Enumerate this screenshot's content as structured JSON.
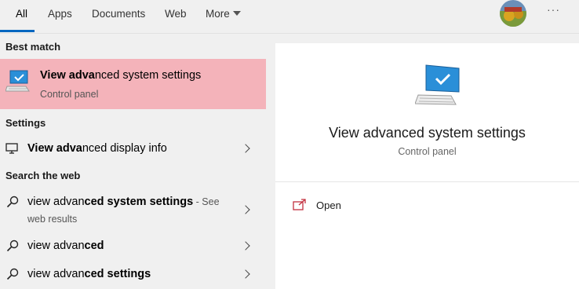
{
  "tabs": {
    "all": "All",
    "apps": "Apps",
    "documents": "Documents",
    "web": "Web",
    "more": "More"
  },
  "overflow_label": "···",
  "results": {
    "best_match_header": "Best match",
    "best_match": {
      "title_bold": "View adva",
      "title_rest": "nced system settings",
      "subtitle": "Control panel"
    },
    "settings_header": "Settings",
    "settings_item": {
      "bold": "View adva",
      "rest": "nced display info"
    },
    "web_header": "Search the web",
    "web_items": [
      {
        "normal": "view advan",
        "bold": "ced system settings",
        "suffix": " - See",
        "sub": "web results"
      },
      {
        "normal": "view advan",
        "bold": "ced",
        "suffix": "",
        "sub": ""
      },
      {
        "normal": "view advan",
        "bold": "ced settings",
        "suffix": "",
        "sub": ""
      }
    ]
  },
  "preview": {
    "title": "View advanced system settings",
    "subtitle": "Control panel",
    "open_label": "Open"
  },
  "colors": {
    "highlight": "#f4b3ba",
    "accent": "#0067c0",
    "icon_blue": "#2a8fd8"
  },
  "icons": {
    "best_match": "computer-monitor-icon",
    "settings": "display-icon",
    "web": "search-icon",
    "open": "open-icon"
  }
}
